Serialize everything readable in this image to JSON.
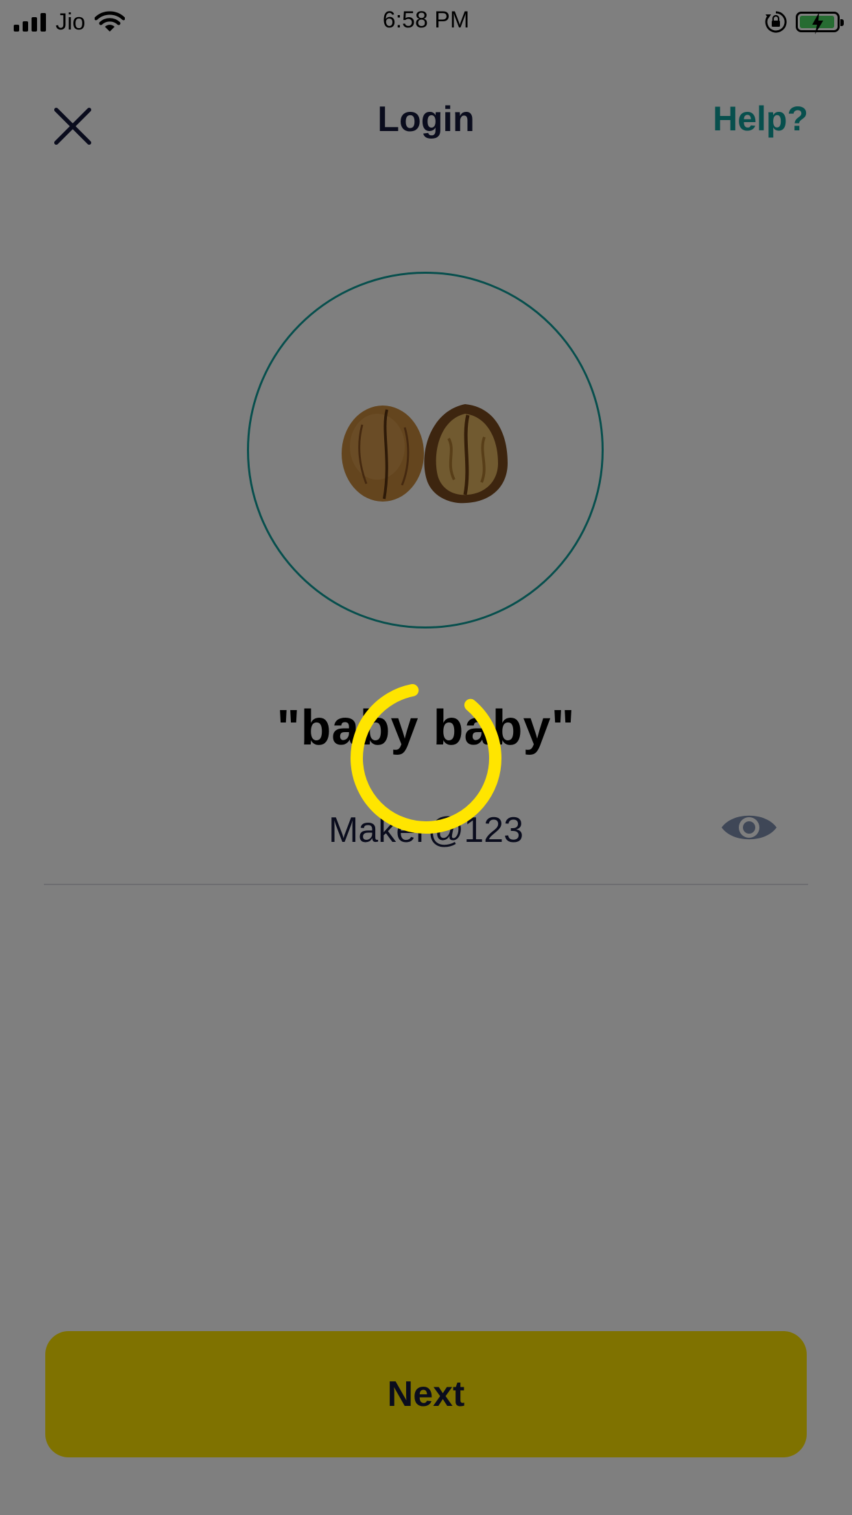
{
  "status_bar": {
    "carrier": "Jio",
    "time": "6:58 PM",
    "battery_fraction": 0.85,
    "icons": [
      "signal-bars-icon",
      "wifi-icon",
      "rotation-lock-icon",
      "battery-charging-icon"
    ]
  },
  "header": {
    "title": "Login",
    "help_label": "Help?",
    "close_icon": "close-icon"
  },
  "avatar": {
    "icon": "walnut-icon"
  },
  "user": {
    "name": "\"baby baby\""
  },
  "password": {
    "value": "Maker@123",
    "visibility_icon": "eye-icon"
  },
  "actions": {
    "next_label": "Next"
  },
  "loading": {
    "visible": true,
    "icon": "loading-spinner-icon"
  },
  "colors": {
    "accent": "#0f9e9b",
    "primary_button": "#ffe500",
    "title_text": "#14193a",
    "spinner": "#ffe500",
    "battery": "#4cd964"
  }
}
